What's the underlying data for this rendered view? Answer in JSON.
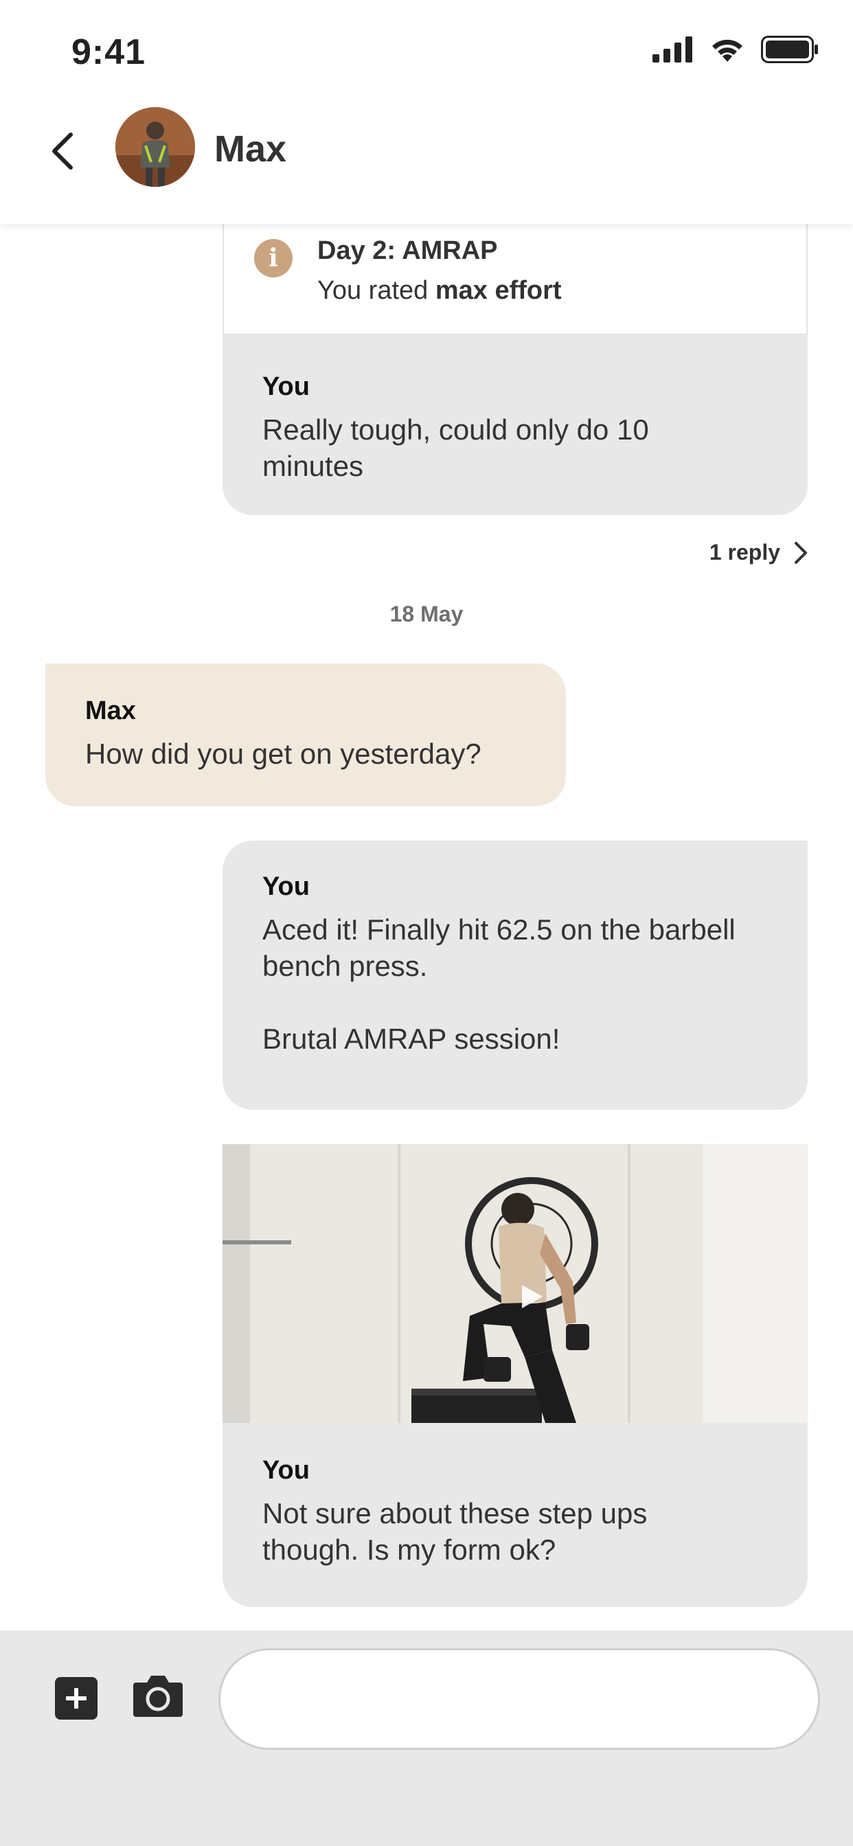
{
  "status_bar": {
    "time": "9:41"
  },
  "header": {
    "contact_name": "Max"
  },
  "info_card": {
    "title": "Day 2: AMRAP",
    "rated_prefix": "You rated",
    "rated_value": "max effort"
  },
  "messages": [
    {
      "sender": "You",
      "text": "Really tough, could only do 10 minutes"
    },
    {
      "sender": "Max",
      "text": "How did you get on yesterday?"
    },
    {
      "sender": "You",
      "text_line1": "Aced it! Finally hit 62.5 on the barbell bench press.",
      "text_line2": "Brutal AMRAP session!"
    },
    {
      "sender": "You",
      "text": "Not sure about these step ups though. Is my form ok?"
    }
  ],
  "thread": {
    "reply_label": "1 reply"
  },
  "date_divider": "18 May",
  "composer": {
    "placeholder": ""
  },
  "colors": {
    "you_bubble": "#e8e8e8",
    "max_bubble": "#f2e9dd",
    "info_icon": "#c9a47f",
    "bottom_bar": "#e8e8e8"
  }
}
